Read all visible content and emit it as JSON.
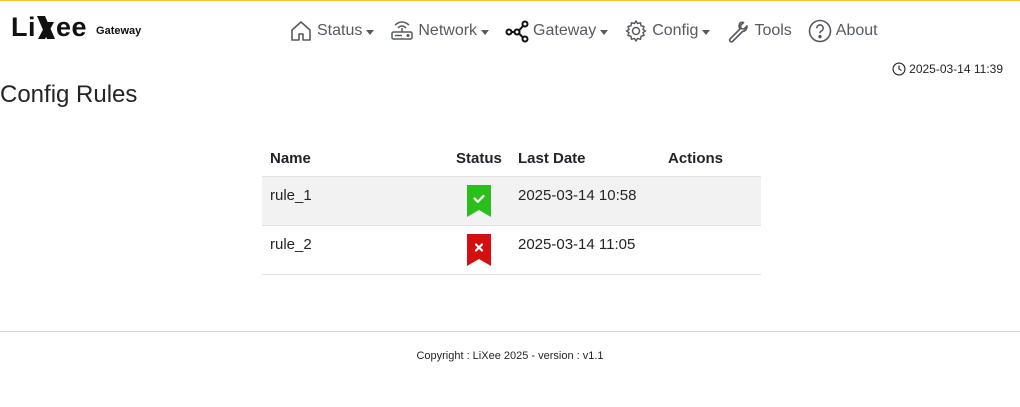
{
  "brand": {
    "logo_text": "Li",
    "logo_text2": "ee",
    "subtitle": "Gateway"
  },
  "nav": {
    "items": [
      {
        "label": "Status",
        "icon": "house-icon",
        "dropdown": true
      },
      {
        "label": "Network",
        "icon": "router-icon",
        "dropdown": true
      },
      {
        "label": "Gateway",
        "icon": "diagram-icon",
        "dropdown": true
      },
      {
        "label": "Config",
        "icon": "gear-icon",
        "dropdown": true
      },
      {
        "label": "Tools",
        "icon": "wrench-icon",
        "dropdown": false
      },
      {
        "label": "About",
        "icon": "question-circle-icon",
        "dropdown": false
      }
    ]
  },
  "clock": {
    "datetime": "2025-03-14 11:39",
    "icon": "clock-icon"
  },
  "page": {
    "title": "Config Rules"
  },
  "table": {
    "headers": {
      "name": "Name",
      "status": "Status",
      "last_date": "Last Date",
      "actions": "Actions"
    },
    "rows": [
      {
        "name": "rule_1",
        "status": "ok",
        "status_icon": "bookmark-check-icon",
        "status_color": "#2bbf1b",
        "last_date": "2025-03-14 10:58",
        "actions": ""
      },
      {
        "name": "rule_2",
        "status": "error",
        "status_icon": "bookmark-x-icon",
        "status_color": "#d40f0f",
        "last_date": "2025-03-14 11:05",
        "actions": ""
      }
    ]
  },
  "footer": {
    "text": "Copyright : LiXee 2025 - version : v1.1"
  },
  "colors": {
    "accent_line": "#f2c12e",
    "nav_text": "#555b61"
  }
}
